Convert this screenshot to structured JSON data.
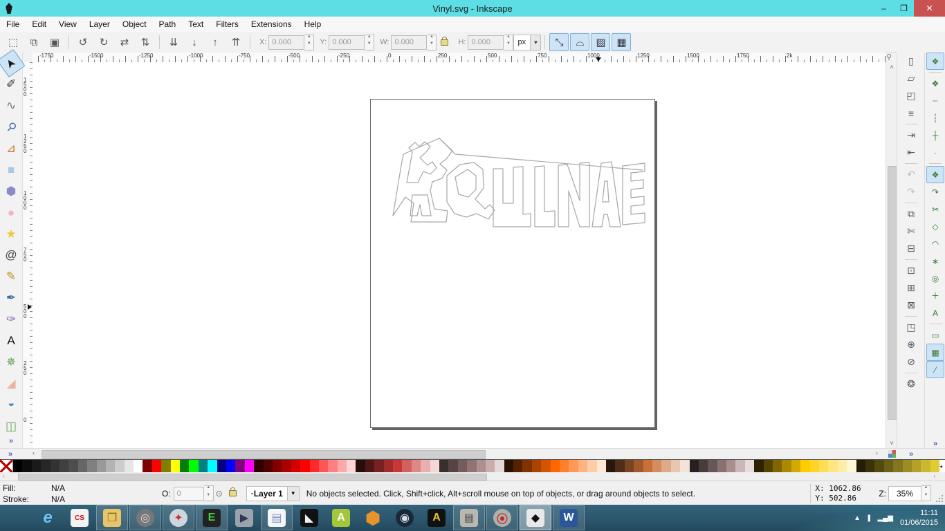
{
  "window": {
    "title": "Vinyl.svg - Inkscape",
    "controls": [
      {
        "name": "minimize-button",
        "glyph": "–"
      },
      {
        "name": "restore-button",
        "glyph": "❐"
      },
      {
        "name": "close-button",
        "glyph": "✕"
      }
    ]
  },
  "menubar": [
    "File",
    "Edit",
    "View",
    "Layer",
    "Object",
    "Path",
    "Text",
    "Filters",
    "Extensions",
    "Help"
  ],
  "selector_toolbar": {
    "buttons": [
      {
        "name": "select-all-button",
        "glyph": "⬚"
      },
      {
        "name": "select-all-layers-button",
        "glyph": "⧉"
      },
      {
        "name": "deselect-button",
        "glyph": "▣"
      },
      {
        "name": "sep"
      },
      {
        "name": "rotate-ccw-button",
        "glyph": "↺"
      },
      {
        "name": "rotate-cw-button",
        "glyph": "↻"
      },
      {
        "name": "flip-horizontal-button",
        "glyph": "⇄"
      },
      {
        "name": "flip-vertical-button",
        "glyph": "⇅"
      },
      {
        "name": "sep"
      },
      {
        "name": "lower-to-bottom-button",
        "glyph": "⇊"
      },
      {
        "name": "lower-button",
        "glyph": "↓"
      },
      {
        "name": "raise-button",
        "glyph": "↑"
      },
      {
        "name": "raise-to-top-button",
        "glyph": "⇈"
      },
      {
        "name": "sep"
      }
    ],
    "fields": [
      {
        "name": "x-field",
        "label": "X:",
        "value": "0.000"
      },
      {
        "name": "y-field",
        "label": "Y:",
        "value": "0.000"
      },
      {
        "name": "w-field",
        "label": "W:",
        "value": "0.000"
      },
      {
        "name": "lock"
      },
      {
        "name": "h-field",
        "label": "H:",
        "value": "0.000"
      }
    ],
    "units": "px",
    "affect_toggles": [
      {
        "name": "scale-stroke-toggle",
        "glyph": "⤡"
      },
      {
        "name": "scale-corners-toggle",
        "glyph": "⌓"
      },
      {
        "name": "move-gradients-toggle",
        "glyph": "▨"
      },
      {
        "name": "move-patterns-toggle",
        "glyph": "▦"
      }
    ]
  },
  "rulers": {
    "horizontal": [
      "-1750",
      "-1500",
      "-1250",
      "-1000",
      "-750",
      "-500",
      "-250",
      "0",
      "250",
      "500",
      "750",
      "1000",
      "1250",
      "1500",
      "1750",
      "2k"
    ],
    "vertical": [
      "1500",
      "1250",
      "1000",
      "750",
      "500",
      "250",
      "0"
    ]
  },
  "toolbox": {
    "tools": [
      {
        "name": "selector-tool",
        "glyph": "➤",
        "color": "#1a1a1a",
        "active": true,
        "rot": -125
      },
      {
        "name": "node-editor-tool",
        "glyph": "✐",
        "color": "#334",
        "rot": 0
      },
      {
        "name": "tweak-tool",
        "glyph": "∿",
        "color": "#778",
        "rot": 0
      },
      {
        "name": "zoom-tool",
        "glyph": "⚲",
        "color": "#3a6ea5",
        "rot": 45
      },
      {
        "name": "measure-tool",
        "glyph": "⊿",
        "color": "#c77d2e",
        "rot": 0
      },
      {
        "name": "rectangle-tool",
        "glyph": "■",
        "color": "#a9c9e4",
        "rot": 0
      },
      {
        "name": "box3d-tool",
        "glyph": "⬢",
        "color": "#8a8ac8",
        "rot": 0
      },
      {
        "name": "ellipse-tool",
        "glyph": "●",
        "color": "#f2b5c0",
        "rot": 0
      },
      {
        "name": "star-tool",
        "glyph": "★",
        "color": "#edc93c",
        "rot": 0
      },
      {
        "name": "spiral-tool",
        "glyph": "@",
        "color": "#444",
        "rot": 0
      },
      {
        "name": "pencil-tool",
        "glyph": "✎",
        "color": "#b89418",
        "rot": 0
      },
      {
        "name": "bezier-pen-tool",
        "glyph": "✒",
        "color": "#3a6ea5",
        "rot": 0
      },
      {
        "name": "calligraphy-tool",
        "glyph": "✑",
        "color": "#8a6ab0",
        "rot": 0
      },
      {
        "name": "text-tool",
        "glyph": "A",
        "color": "#111",
        "rot": 0
      },
      {
        "name": "spray-tool",
        "glyph": "✵",
        "color": "#5fa050",
        "rot": 0
      },
      {
        "name": "eraser-tool",
        "glyph": "◢",
        "color": "#eeb3a0",
        "rot": 0
      },
      {
        "name": "paint-bucket-tool",
        "glyph": "◗",
        "color": "#4a90c2",
        "rot": 90
      },
      {
        "name": "gradient-tool",
        "glyph": "◫",
        "color": "#5fa050",
        "rot": 0
      }
    ],
    "overflow": "»"
  },
  "commands_bar": [
    {
      "name": "new-document-button",
      "glyph": "▯"
    },
    {
      "name": "open-button",
      "glyph": "▱"
    },
    {
      "name": "save-button",
      "glyph": "◰"
    },
    {
      "name": "print-button",
      "glyph": "≡"
    },
    {
      "name": "sep"
    },
    {
      "name": "import-button",
      "glyph": "⇥"
    },
    {
      "name": "export-button",
      "glyph": "⇤"
    },
    {
      "name": "sep"
    },
    {
      "name": "undo-button",
      "glyph": "↶",
      "disabled": true
    },
    {
      "name": "redo-button",
      "glyph": "↷",
      "disabled": true
    },
    {
      "name": "sep"
    },
    {
      "name": "copy-button",
      "glyph": "⧉"
    },
    {
      "name": "cut-button",
      "glyph": "✄"
    },
    {
      "name": "paste-button",
      "glyph": "⊟"
    },
    {
      "name": "sep"
    },
    {
      "name": "zoom-selection-button",
      "glyph": "⊡"
    },
    {
      "name": "zoom-drawing-button",
      "glyph": "⊞"
    },
    {
      "name": "zoom-page-button",
      "glyph": "⊠"
    },
    {
      "name": "sep"
    },
    {
      "name": "duplicate-button",
      "glyph": "◳"
    },
    {
      "name": "create-clone-button",
      "glyph": "⊕"
    },
    {
      "name": "unlink-clone-button",
      "glyph": "⊘"
    },
    {
      "name": "sep"
    },
    {
      "name": "xml-editor-button",
      "glyph": "❂"
    }
  ],
  "snap_bar": [
    {
      "name": "snap-enable-toggle",
      "glyph": "❖",
      "active": true
    },
    {
      "name": "sep"
    },
    {
      "name": "snap-bbox-toggle",
      "glyph": "❖"
    },
    {
      "name": "snap-bbox-edges-toggle",
      "glyph": "┄"
    },
    {
      "name": "snap-bbox-corners-toggle",
      "glyph": "┆"
    },
    {
      "name": "snap-bbox-midpoints-toggle",
      "glyph": "┼"
    },
    {
      "name": "snap-bbox-centers-toggle",
      "glyph": "·"
    },
    {
      "name": "sep"
    },
    {
      "name": "snap-nodes-toggle",
      "glyph": "❖",
      "active": true
    },
    {
      "name": "snap-paths-toggle",
      "glyph": "↷"
    },
    {
      "name": "snap-intersections-toggle",
      "glyph": "✂"
    },
    {
      "name": "snap-cusp-nodes-toggle",
      "glyph": "◇"
    },
    {
      "name": "snap-smooth-nodes-toggle",
      "glyph": "◠"
    },
    {
      "name": "snap-midpoints-toggle",
      "glyph": "∗"
    },
    {
      "name": "snap-object-centers-toggle",
      "glyph": "◎"
    },
    {
      "name": "snap-rotation-centers-toggle",
      "glyph": "＋"
    },
    {
      "name": "snap-text-baseline-toggle",
      "glyph": "A"
    },
    {
      "name": "sep"
    },
    {
      "name": "snap-page-border-toggle",
      "glyph": "▭"
    },
    {
      "name": "snap-grid-toggle",
      "glyph": "▦",
      "active": true
    },
    {
      "name": "snap-guides-toggle",
      "glyph": "∕",
      "active": true
    }
  ],
  "scroll_glyphs": {
    "up": "˄",
    "down": "˅",
    "left": "‹",
    "right": "›",
    "overflow": "»"
  },
  "artwork": {
    "stroke": "#a6a6a6",
    "paths": [
      "M32 168 L44 95 L47 79 L99 56 L118 74 L109 86 L100 93 L110 102 L103 114 L89 119 L86 132 L92 158 L111 161 L109 177 L58 177 L62 150 L50 141 Z",
      "M52 120 L60 76 L55 70 L64 62 L70 68 L78 61 L86 68 L79 77 L71 84 L82 95 L89 90 L95 99 L86 108 L76 104 L68 120 Z",
      "M57 168 L60 138 L82 138 L87 168 L74 168 L71 152 L67 168 Z",
      "M99 56 L122 79 L393 102",
      "M110 110 L129 94 L149 91 L162 101 L163 128 L151 144 L165 158 L172 152 L179 160 L170 173 L153 165 L138 170 L121 165 L110 148 Z",
      "M122 112 L140 101 L152 110 L152 130 L141 141 L127 137 Z",
      "M177 100 L177 184 L231 184 L231 165 L220 166 L220 97 L206 98 L206 150 L191 150 L191 100 Z",
      "M237 97 L251 96 L251 162 L266 161 L266 184 L237 184 Z",
      "M271 184 L271 95 L284 94 L302 146 L302 92 L316 91 L316 184 L302 184 L286 132 L286 184 Z",
      "M320 184 L333 92 L348 90 L361 184 L346 184 L342 166 L337 166 L334 184 Z",
      "M338 118 L342 118 L344 148 L335 148 Z",
      "M364 96 L396 92 L396 104 L376 106 L376 118 L394 116 L394 128 L376 130 L376 142 L395 140 L395 152 L376 154 L376 166 L396 164 L396 178 L364 181 Z"
    ]
  },
  "palette": {
    "colors": [
      "#000000",
      "#0d0d0d",
      "#1a1a1a",
      "#262626",
      "#333333",
      "#404040",
      "#4d4d4d",
      "#666666",
      "#808080",
      "#999999",
      "#b3b3b3",
      "#cccccc",
      "#e6e6e6",
      "#ffffff",
      "#800000",
      "#ff0000",
      "#808000",
      "#ffff00",
      "#008000",
      "#00ff00",
      "#008080",
      "#00ffff",
      "#000080",
      "#0000ff",
      "#800080",
      "#ff00ff",
      "#2b0000",
      "#550000",
      "#800000",
      "#aa0000",
      "#d40000",
      "#ff0000",
      "#ff2a2a",
      "#ff5555",
      "#ff8080",
      "#ffaaaa",
      "#ffd5d5",
      "#280b0b",
      "#501616",
      "#782121",
      "#a02c2c",
      "#c83737",
      "#d35f5f",
      "#de8787",
      "#e9afaf",
      "#f4d7d7",
      "#3a2e2e",
      "#574545",
      "#745c5c",
      "#917373",
      "#ad8f8f",
      "#c9acac",
      "#e5d8d8",
      "#2b1100",
      "#552200",
      "#803300",
      "#aa4400",
      "#d45500",
      "#ff6600",
      "#ff7f2a",
      "#ff9955",
      "#ffb380",
      "#ffccaa",
      "#ffe6d5",
      "#28170b",
      "#502d16",
      "#784421",
      "#a05a2c",
      "#c87137",
      "#d38d5f",
      "#deaa87",
      "#e9c6af",
      "#f4e3d7",
      "#262020",
      "#473b3b",
      "#685656",
      "#897171",
      "#aa8d8d",
      "#ccb7b7",
      "#e8dbdb",
      "#2b2200",
      "#554400",
      "#806600",
      "#aa8800",
      "#d4aa00",
      "#ffcc00",
      "#ffd42a",
      "#ffdd55",
      "#ffe680",
      "#ffeeaa",
      "#fff6d5",
      "#241e05",
      "#3c320a",
      "#544a10",
      "#6c6016",
      "#84761c",
      "#9c8c22",
      "#b4a228",
      "#ccb82e",
      "#e0cc34"
    ]
  },
  "statusbar": {
    "fill_label": "Fill:",
    "fill_value": "N/A",
    "stroke_label": "Stroke:",
    "stroke_value": "N/A",
    "opacity_label": "O:",
    "opacity_value": "0",
    "layer_bullet": "·",
    "layer_name": "Layer 1",
    "message": "No objects selected. Click, Shift+click, Alt+scroll mouse on top of objects, or drag around objects to select.",
    "x_label": "X:",
    "x_value": "1062.86",
    "y_label": "Y:",
    "y_value": "502.86",
    "zoom_label": "Z:",
    "zoom_value": "35%"
  },
  "taskbar": {
    "items": [
      {
        "name": "start-button",
        "start": true
      },
      {
        "name": "internet-explorer-icon",
        "glyph": "e",
        "bg": "transparent",
        "fg": "#6ec6f0",
        "fs": 24,
        "italic": true
      },
      {
        "name": "eagle-cad-icon",
        "glyph": "CS",
        "bg": "#f2f2f2",
        "fg": "#c11",
        "fs": 10
      },
      {
        "name": "file-explorer-icon",
        "glyph": "❒",
        "bg": "#e8c56a",
        "fg": "#8a6a20",
        "framed": true
      },
      {
        "name": "disc-player-icon",
        "glyph": "◎",
        "bg": "#777",
        "fg": "#ddd",
        "framed": true
      },
      {
        "name": "safari-icon",
        "glyph": "✦",
        "bg": "#cdd5de",
        "fg": "#c33",
        "framed": true
      },
      {
        "name": "terminal-icon",
        "glyph": "E",
        "bg": "#222",
        "fg": "#4c4",
        "framed": true
      },
      {
        "name": "video-app-icon",
        "glyph": "▶",
        "bg": "#9aa4aa",
        "fg": "#335"
      },
      {
        "name": "notepad-icon",
        "glyph": "▤",
        "bg": "#f4f6f8",
        "fg": "#7d93b8",
        "framed": true
      },
      {
        "name": "dark-app-icon",
        "glyph": "◣",
        "bg": "#111",
        "fg": "#eee"
      },
      {
        "name": "android-studio-icon",
        "glyph": "A",
        "bg": "#a4c639",
        "fg": "#fff"
      },
      {
        "name": "cube-app-icon",
        "glyph": "⬢",
        "bg": "transparent",
        "fg": "#e8932c",
        "fs": 26
      },
      {
        "name": "steam-icon",
        "glyph": "◉",
        "bg": "#1b2838",
        "fg": "#cfe3f0"
      },
      {
        "name": "atom-a-icon",
        "glyph": "A",
        "bg": "#111",
        "fg": "#e8c52c"
      },
      {
        "name": "bricks-app-icon",
        "glyph": "▦",
        "bg": "#b8b8b0",
        "fg": "#666",
        "framed": true
      },
      {
        "name": "screen-recorder-icon",
        "glyph": "⦿",
        "bg": "#aab2aa",
        "fg": "#c22",
        "framed": true
      },
      {
        "name": "inkscape-icon",
        "glyph": "◆",
        "bg": "#e8e8e8",
        "fg": "#111",
        "framed": true,
        "active": true
      },
      {
        "name": "word-icon",
        "glyph": "W",
        "bg": "#2b579a",
        "fg": "#fff",
        "framed": true
      }
    ],
    "tray": {
      "up_arrow": "▲",
      "pen_icon": "❚",
      "signal_icon": "▂▄▆",
      "time": "11:11",
      "date": "01/06/2015"
    }
  }
}
